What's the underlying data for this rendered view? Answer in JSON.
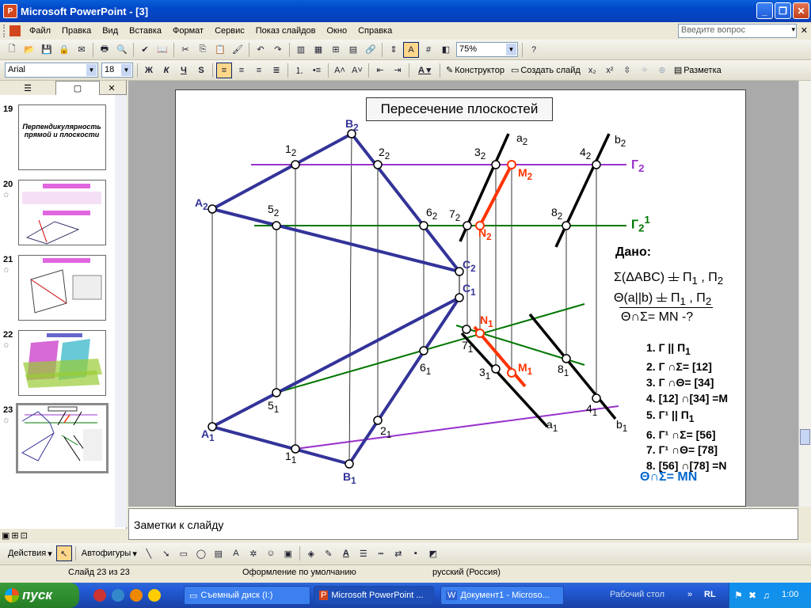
{
  "window": {
    "title": "Microsoft PowerPoint - [3]",
    "app_icon": "P"
  },
  "menu": {
    "items": [
      "Файл",
      "Правка",
      "Вид",
      "Вставка",
      "Формат",
      "Сервис",
      "Показ слайдов",
      "Окно",
      "Справка"
    ],
    "help_placeholder": "Введите вопрос"
  },
  "standard_toolbar": {
    "zoom": "75%"
  },
  "format_toolbar": {
    "font": "Arial",
    "size": "18",
    "bold": "Ж",
    "italic": "К",
    "underline": "Ч",
    "shadow": "S",
    "designer": "Конструктор",
    "new_slide": "Создать слайд",
    "layout": "Разметка"
  },
  "thumbnails": [
    {
      "num": "19",
      "title": "Перпендикулярность прямой и плоскости"
    },
    {
      "num": "20"
    },
    {
      "num": "21"
    },
    {
      "num": "22"
    },
    {
      "num": "23",
      "selected": true
    }
  ],
  "slide": {
    "title": "Пересечение  плоскостей",
    "labels": {
      "B2": "B",
      "B2s": "2",
      "A2": "A",
      "A2s": "2",
      "p12": "1",
      "p12s": "2",
      "p22": "2",
      "p22s": "2",
      "p52": "5",
      "p52s": "2",
      "p62": "6",
      "p62s": "2",
      "p72": "7",
      "p72s": "2",
      "p82": "8",
      "p82s": "2",
      "p32": "3",
      "p32s": "2",
      "p42": "4",
      "p42s": "2",
      "a2": "a",
      "a2s": "2",
      "b2": "b",
      "b2s": "2",
      "M2": "M",
      "M2s": "2",
      "N2": "N",
      "N2s": "2",
      "G2": "Г",
      "G2s": "2",
      "G21": "Г",
      "G21s": "2",
      "G21p": "1",
      "C2": "C",
      "C2s": "2",
      "C1": "C",
      "C1s": "1",
      "N1": "N",
      "N1s": "1",
      "M1": "M",
      "M1s": "1",
      "p71": "7",
      "p71s": "1",
      "p61": "6",
      "p61s": "1",
      "p31": "3",
      "p31s": "1",
      "p81": "8",
      "p81s": "1",
      "p51": "5",
      "p51s": "1",
      "p41": "4",
      "p41s": "1",
      "p21": "2",
      "p21s": "1",
      "p11": "1",
      "p11s": "1",
      "A1": "A",
      "A1s": "1",
      "B1": "B",
      "B1s": "1",
      "a1": "a",
      "a1s": "1",
      "b1": "b",
      "b1s": "1"
    },
    "given": {
      "heading": "Дано:",
      "line1a": "Σ(ΔABC) ",
      "line1b": "⊥",
      "line1c": " П",
      "line1d": "1",
      "line1e": " , П",
      "line1f": "2",
      "line2a": "Θ(a||b) ",
      "line2b": "⊥",
      "line2c": " П",
      "line2d": "1",
      "line2e": " , П",
      "line2f": "2",
      "line3": "Θ∩Σ= MN  -?"
    },
    "steps": [
      {
        "t": "1. Г || П",
        "s": "1"
      },
      {
        "t": "2. Г ∩Σ= [12]"
      },
      {
        "t": "3. Г ∩Θ= [34]"
      },
      {
        "t": "4. [12] ∩[34] =M"
      },
      {
        "t": "5. Г¹ || П",
        "s": "1"
      },
      {
        "t": "6. Г¹ ∩Σ= [56]"
      },
      {
        "t": "7. Г¹ ∩Θ= [78]"
      },
      {
        "t": "8. [56] ∩[78] =N"
      }
    ],
    "answer": "Θ∩Σ= MN"
  },
  "notes_placeholder": "Заметки к слайду",
  "draw_toolbar": {
    "actions": "Действия",
    "autoshapes": "Автофигуры"
  },
  "status": {
    "slide": "Слайд 23 из 23",
    "design": "Оформление по умолчанию",
    "lang": "русский (Россия)"
  },
  "taskbar": {
    "start": "пуск",
    "tasks": [
      "Съемный диск (I:)",
      "Microsoft PowerPoint ...",
      "Документ1 - Microso..."
    ],
    "desktop": "Рабочий стол",
    "lang": "RL",
    "time": "1:00"
  },
  "colors": {
    "titlebar": "#0047c8",
    "triangle": "#333399",
    "gamma": "#9933cc",
    "gamma1": "#007700",
    "mn": "#ff3300",
    "answer": "#0066cc"
  }
}
